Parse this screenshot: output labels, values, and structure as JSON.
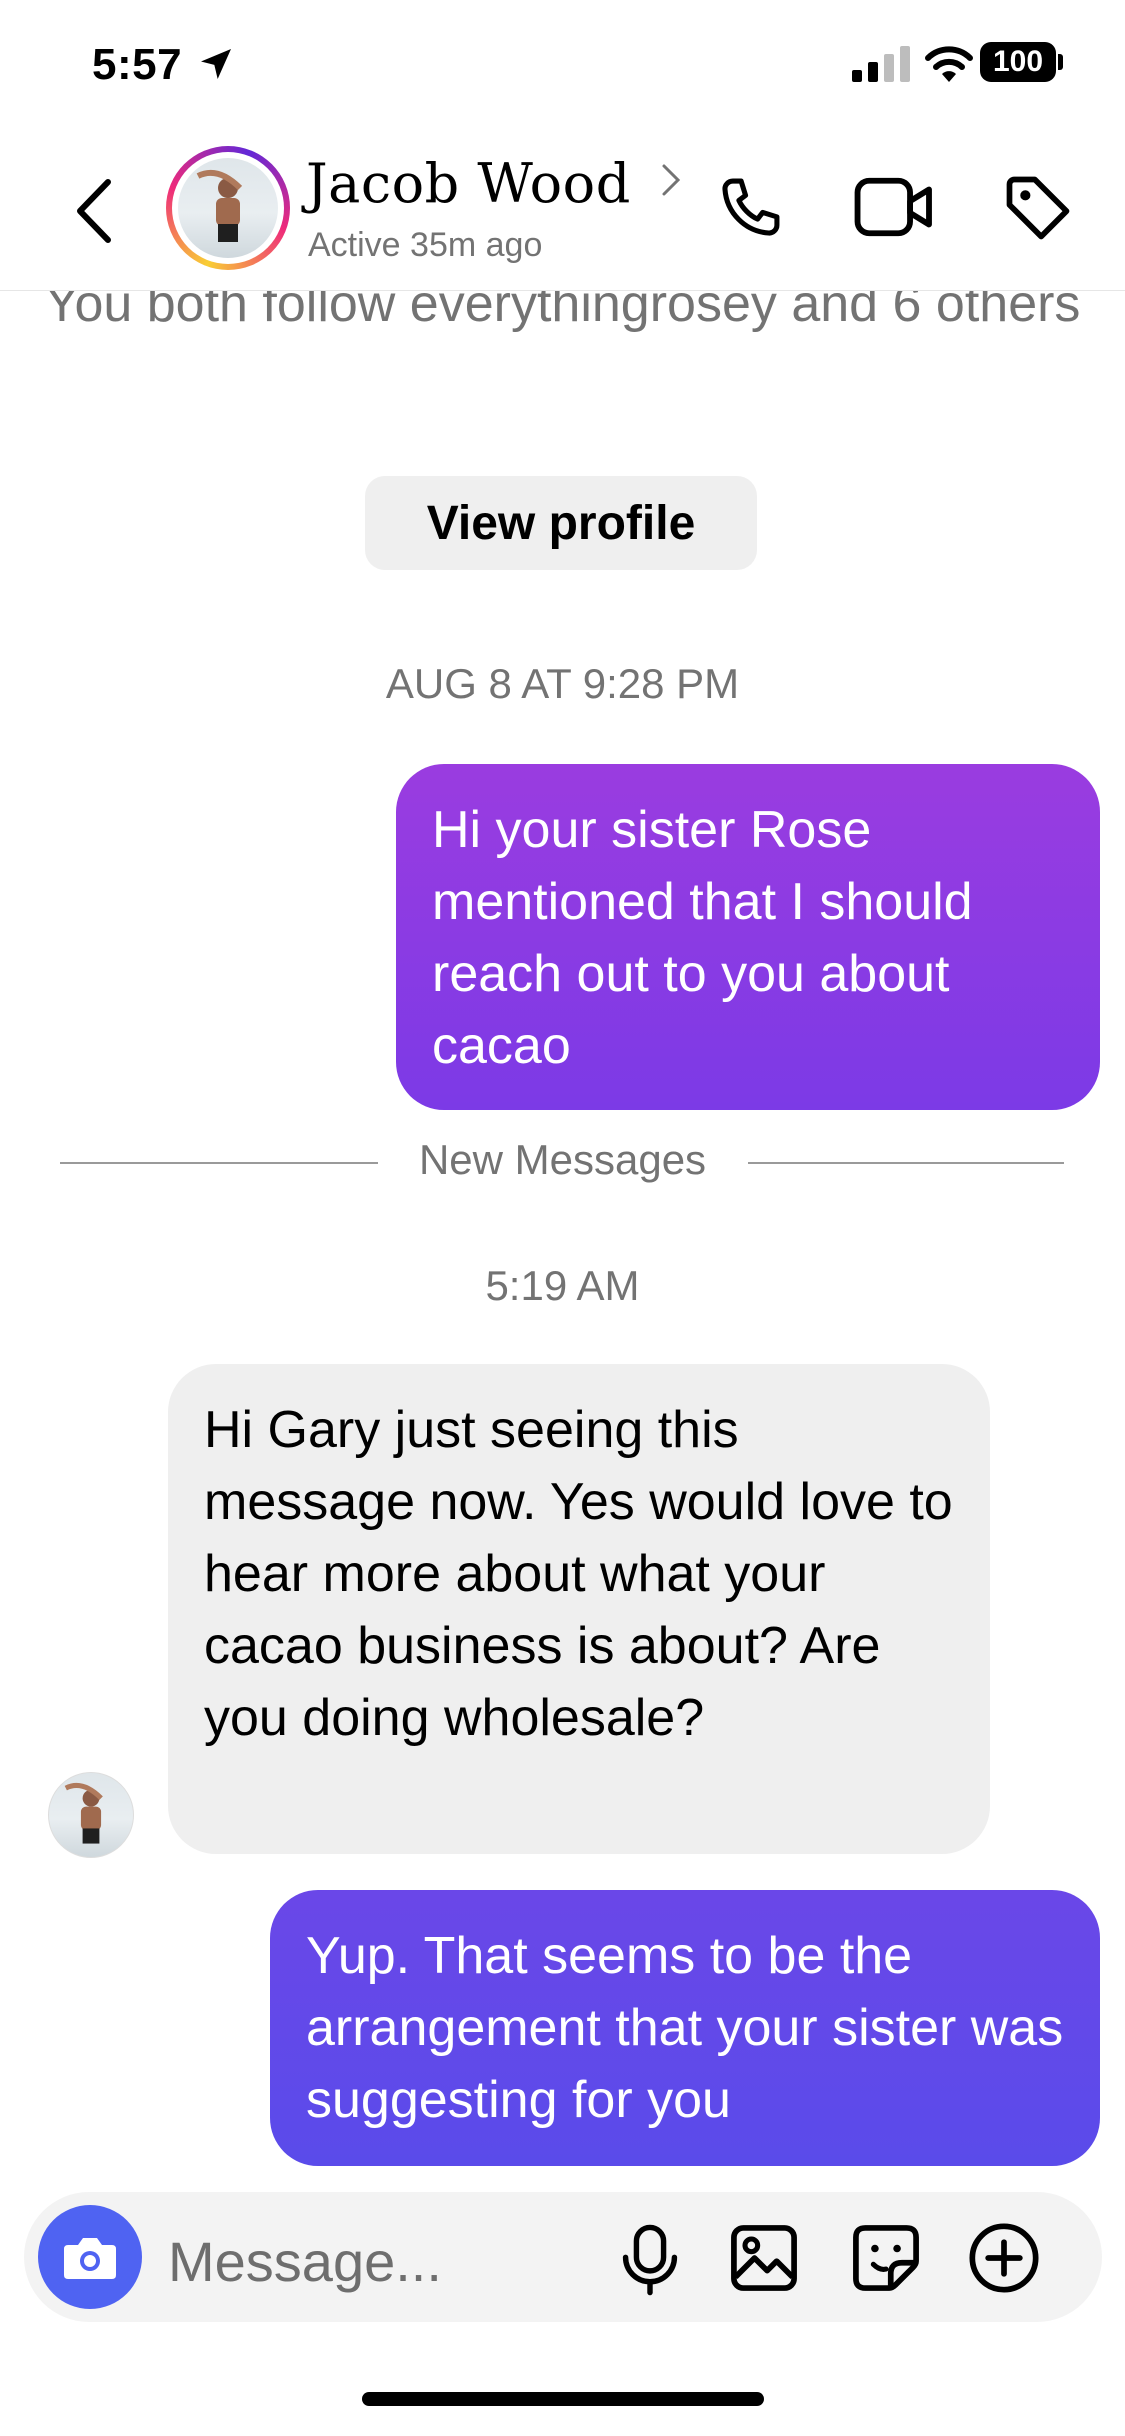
{
  "status_bar": {
    "time": "5:57",
    "battery": "100"
  },
  "header": {
    "contact_name": "Jacob Wood",
    "active_status": "Active 35m ago"
  },
  "profile_info": {
    "mutual_followers": "You both follow everythingrosey and 6 others",
    "view_profile_label": "View profile"
  },
  "messages": [
    {
      "direction": "out",
      "text": "Hi your sister  Rose mentioned that I should reach out to you about cacao"
    },
    {
      "direction": "in",
      "text": "Hi Gary just seeing this message now.  Yes would love to hear more about what your cacao business is about?  Are you doing wholesale?"
    },
    {
      "direction": "out",
      "text": "Yup. That seems to be the arrangement that your sister was suggesting for you"
    }
  ],
  "timestamps": {
    "first": "AUG 8 AT 9:28 PM",
    "second": "5:19 AM"
  },
  "new_messages_label": "New Messages",
  "composer": {
    "placeholder": "Message..."
  },
  "colors": {
    "outgoing_top": "#9a3ce0",
    "outgoing_bottom": "#5a4bea",
    "camera_button": "#4f63f2"
  },
  "icons": [
    "back-chevron",
    "phone",
    "video-camera",
    "tag",
    "location-arrow",
    "signal",
    "wifi",
    "camera",
    "microphone",
    "gallery",
    "sticker",
    "plus-circle"
  ]
}
